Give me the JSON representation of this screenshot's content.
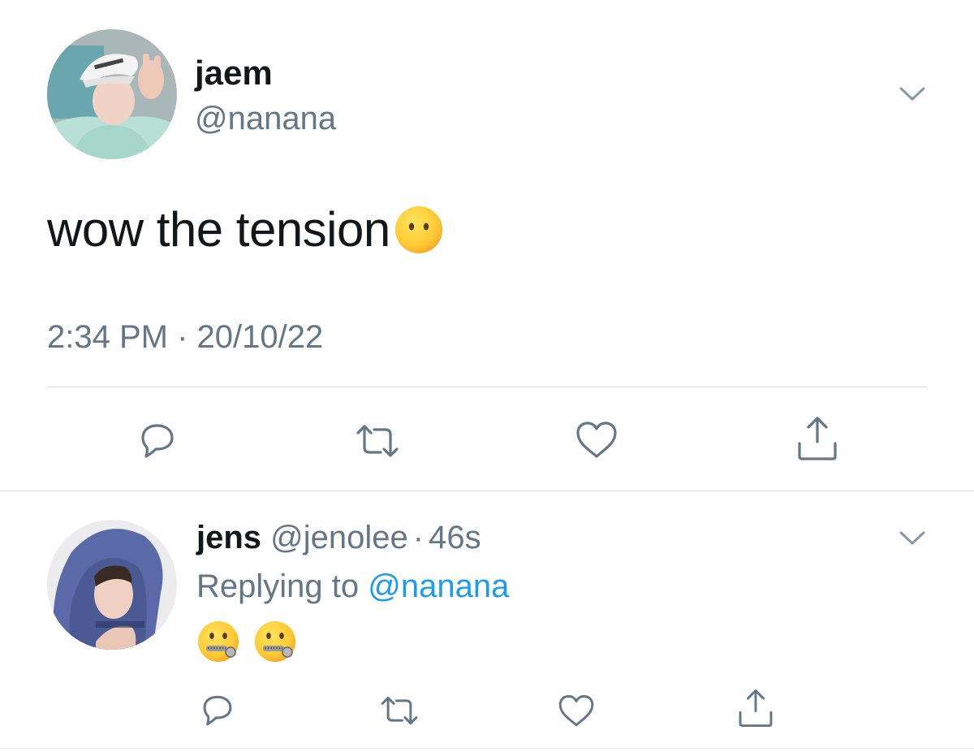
{
  "main_tweet": {
    "name": "jaem",
    "handle": "@nanana",
    "text": "wow the tension",
    "emoji": "neutral-face-no-mouth",
    "timestamp": "2:34 PM · 20/10/22",
    "actions": [
      "reply-icon",
      "retweet-icon",
      "like-icon",
      "share-icon"
    ]
  },
  "reply_tweet": {
    "name": "jens",
    "handle": "@jenolee",
    "dot": "·",
    "time": "46s",
    "replying_prefix": "Replying to ",
    "replying_handle": "@nanana",
    "emojis": [
      "zipper-mouth-face",
      "zipper-mouth-face"
    ],
    "actions": [
      "reply-icon",
      "retweet-icon",
      "like-icon",
      "share-icon"
    ]
  },
  "colors": {
    "text": "#14171a",
    "secondary": "#657786",
    "link": "#1d9bf0",
    "divider": "#d9dde1"
  }
}
